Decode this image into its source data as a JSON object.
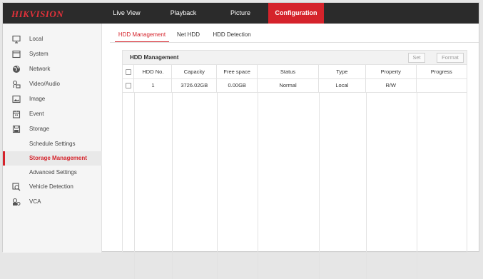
{
  "brand": {
    "logo_text": "HIKVISION",
    "accent": "#d5232b"
  },
  "nav": {
    "items": [
      {
        "label": "Live View"
      },
      {
        "label": "Playback"
      },
      {
        "label": "Picture"
      },
      {
        "label": "Configuration",
        "active": true
      }
    ]
  },
  "sidebar": {
    "items": [
      {
        "label": "Local",
        "icon": "monitor-icon"
      },
      {
        "label": "System",
        "icon": "system-icon"
      },
      {
        "label": "Network",
        "icon": "globe-icon"
      },
      {
        "label": "Video/Audio",
        "icon": "video-audio-icon"
      },
      {
        "label": "Image",
        "icon": "image-icon"
      },
      {
        "label": "Event",
        "icon": "calendar-icon"
      },
      {
        "label": "Storage",
        "icon": "save-icon"
      }
    ],
    "storage_sub": [
      {
        "label": "Schedule Settings"
      },
      {
        "label": "Storage Management",
        "active": true
      },
      {
        "label": "Advanced Settings"
      }
    ],
    "after_items": [
      {
        "label": "Vehicle Detection",
        "icon": "vehicle-detection-icon"
      },
      {
        "label": "VCA",
        "icon": "vca-icon"
      }
    ]
  },
  "tabs": [
    {
      "label": "HDD Management",
      "active": true
    },
    {
      "label": "Net HDD"
    },
    {
      "label": "HDD Detection"
    }
  ],
  "panel": {
    "title": "HDD Management",
    "set_label": "Set",
    "format_label": "Format",
    "columns": [
      "HDD No.",
      "Capacity",
      "Free space",
      "Status",
      "Type",
      "Property",
      "Progress"
    ],
    "rows": [
      {
        "hdd_no": "1",
        "capacity": "3726.02GB",
        "free_space": "0.00GB",
        "status": "Normal",
        "type": "Local",
        "property": "R/W",
        "progress": ""
      }
    ]
  }
}
